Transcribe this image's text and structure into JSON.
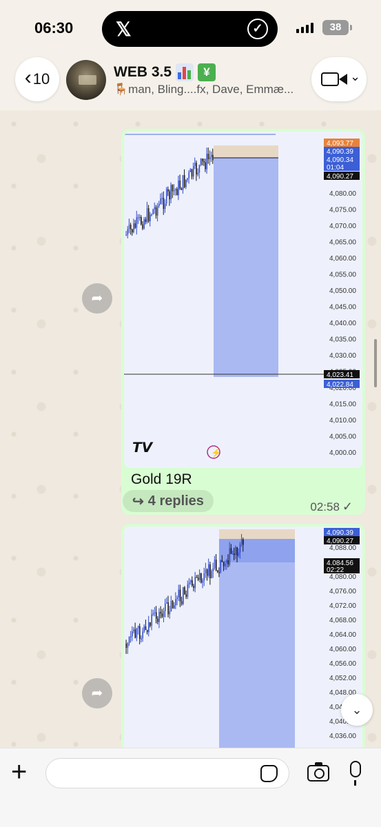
{
  "status_bar": {
    "time": "06:30",
    "battery": "38",
    "island_left_icon": "x-logo-icon",
    "island_right_icon": "check-circle-icon"
  },
  "header": {
    "back_count": "10",
    "group_name": "WEB 3.5",
    "title_emojis": [
      "bar-chart-icon",
      "yen-chart-icon"
    ],
    "members": "🪑man, Bling....fx, Dave, Emmæ..."
  },
  "messages": [
    {
      "caption": "Gold 19R",
      "replies": "4 replies",
      "time": "02:58",
      "status": "✓",
      "chart": {
        "price_labels": [
          "4,080.00",
          "4,075.00",
          "4,070.00",
          "4,065.00",
          "4,060.00",
          "4,055.00",
          "4,050.00",
          "4,045.00",
          "4,040.00",
          "4,035.00",
          "4,030.00",
          "4,025.00",
          "4,020.00",
          "4,015.00",
          "4,010.00",
          "4,005.00",
          "4,000.00"
        ],
        "tags": [
          {
            "text": "4,093.77",
            "color": "#e8823a"
          },
          {
            "text": "4,090.39",
            "color": "#3c5fd6"
          },
          {
            "text": "4,090.34",
            "color": "#3c5fd6"
          },
          {
            "text": "01:04",
            "color": "#3c5fd6"
          },
          {
            "text": "4,090.27",
            "color": "#111111"
          },
          {
            "text": "4,023.41",
            "color": "#111111"
          },
          {
            "text": "4,022.84",
            "color": "#3c5fd6"
          }
        ]
      }
    },
    {
      "chart": {
        "price_labels": [
          "4,088.00",
          "4,084.00",
          "4,080.00",
          "4,076.00",
          "4,072.00",
          "4,068.00",
          "4,064.00",
          "4,060.00",
          "4,056.00",
          "4,052.00",
          "4,048.00",
          "4,044.00",
          "4,040.00",
          "4,036.00"
        ],
        "tags": [
          {
            "text": "4,090.39",
            "color": "#3c5fd6"
          },
          {
            "text": "4,090.27",
            "color": "#111111"
          },
          {
            "text": "4,084.56",
            "color": "#111111"
          },
          {
            "text": "02:22",
            "color": "#111111"
          }
        ]
      }
    }
  ],
  "input": {
    "placeholder": "",
    "value": ""
  },
  "colors": {
    "bubble": "#d9fdd3",
    "short_zone": "#aab9f2",
    "risk_zone": "#e7d8c6",
    "candle_blue": "#3048c8",
    "candle_black": "#111111"
  }
}
